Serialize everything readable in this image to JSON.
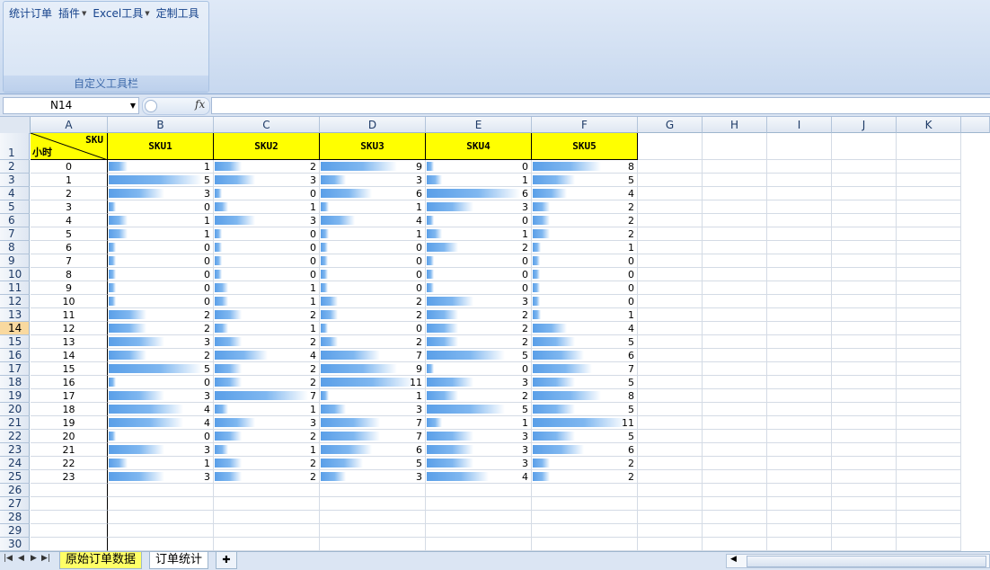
{
  "ribbon": {
    "menu": [
      {
        "label": "统计订单",
        "dropdown": false
      },
      {
        "label": "插件",
        "dropdown": true
      },
      {
        "label": "Excel工具",
        "dropdown": true
      },
      {
        "label": "定制工具",
        "dropdown": false
      }
    ],
    "group_label": "自定义工具栏"
  },
  "formula_bar": {
    "name_box": "N14",
    "fx_label": "fx",
    "formula": ""
  },
  "columns": [
    "A",
    "B",
    "C",
    "D",
    "E",
    "F",
    "G",
    "H",
    "I",
    "J",
    "K"
  ],
  "row_numbers": [
    1,
    2,
    3,
    4,
    5,
    6,
    7,
    8,
    9,
    10,
    11,
    12,
    13,
    14,
    15,
    16,
    17,
    18,
    19,
    20,
    21,
    22,
    23,
    24,
    25,
    26,
    27,
    28,
    29,
    30
  ],
  "active_row": 14,
  "header": {
    "corner_top": "SKU",
    "corner_bottom": "小时",
    "skus": [
      "SKU1",
      "SKU2",
      "SKU3",
      "SKU4",
      "SKU5"
    ]
  },
  "table": {
    "hours": [
      0,
      1,
      2,
      3,
      4,
      5,
      6,
      7,
      8,
      9,
      10,
      11,
      12,
      13,
      14,
      15,
      16,
      17,
      18,
      19,
      20,
      21,
      22,
      23
    ],
    "values": [
      [
        1,
        2,
        9,
        0,
        8
      ],
      [
        5,
        3,
        3,
        1,
        5
      ],
      [
        3,
        0,
        6,
        6,
        4
      ],
      [
        0,
        1,
        1,
        3,
        2
      ],
      [
        1,
        3,
        4,
        0,
        2
      ],
      [
        1,
        0,
        1,
        1,
        2
      ],
      [
        0,
        0,
        0,
        2,
        1
      ],
      [
        0,
        0,
        0,
        0,
        0
      ],
      [
        0,
        0,
        0,
        0,
        0
      ],
      [
        0,
        1,
        0,
        0,
        0
      ],
      [
        0,
        1,
        2,
        3,
        0
      ],
      [
        2,
        2,
        2,
        2,
        1
      ],
      [
        2,
        1,
        0,
        2,
        4
      ],
      [
        3,
        2,
        2,
        2,
        5
      ],
      [
        2,
        4,
        7,
        5,
        6
      ],
      [
        5,
        2,
        9,
        0,
        7
      ],
      [
        0,
        2,
        11,
        3,
        5
      ],
      [
        3,
        7,
        1,
        2,
        8
      ],
      [
        4,
        1,
        3,
        5,
        5
      ],
      [
        4,
        3,
        7,
        1,
        11
      ],
      [
        0,
        2,
        7,
        3,
        5
      ],
      [
        3,
        1,
        6,
        3,
        6
      ],
      [
        1,
        2,
        5,
        3,
        2
      ],
      [
        3,
        2,
        3,
        4,
        2
      ]
    ],
    "column_max": [
      5,
      7,
      11,
      6,
      11
    ],
    "bar_color": "#5a9fe8",
    "header_fill": "#ffff00"
  },
  "sheet_tabs": [
    "原始订单数据",
    "订单统计"
  ],
  "nav_buttons": [
    "first-sheet",
    "prev-sheet",
    "next-sheet",
    "last-sheet"
  ]
}
